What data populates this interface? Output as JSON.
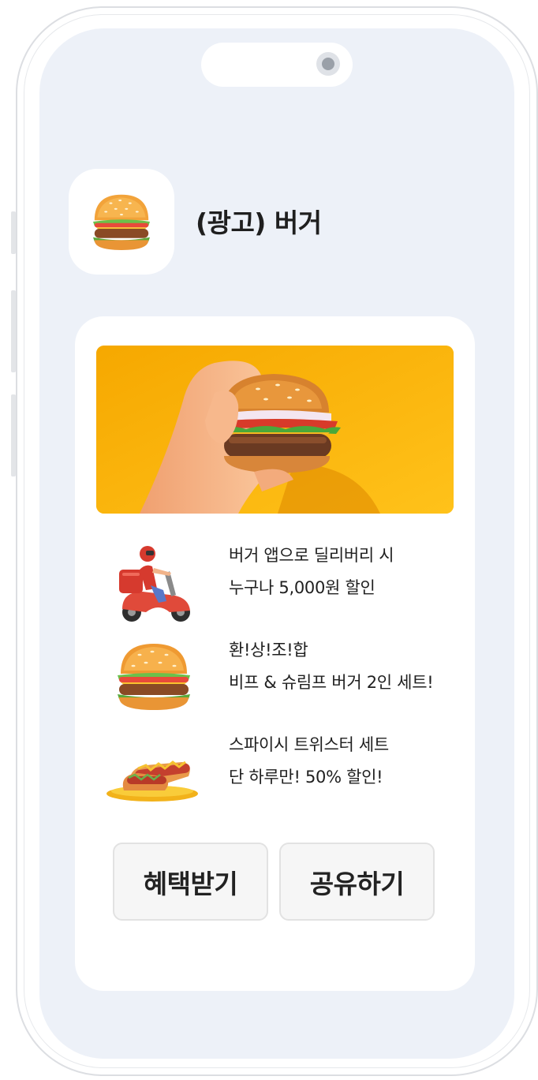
{
  "app": {
    "title": "(광고) 버거",
    "icon": "burger-icon"
  },
  "banner": {
    "image": "hand-holding-burger",
    "background_color": "#fdb50a"
  },
  "features": [
    {
      "icon": "delivery-scooter-icon",
      "line1": "버거 앱으로 딜리버리 시",
      "line2": "누구나 5,000원 할인"
    },
    {
      "icon": "burger-icon",
      "line1": "환!상!조!합",
      "line2": "비프 & 슈림프 버거 2인 세트!"
    },
    {
      "icon": "hotdog-plate-icon",
      "line1": "스파이시 트위스터 세트",
      "line2": "단 하루만! 50% 할인!"
    }
  ],
  "buttons": {
    "benefit": "혜택받기",
    "share": "공유하기"
  },
  "colors": {
    "screen_bg": "#edf1f8",
    "card_bg": "#ffffff",
    "banner_bg": "#fdb50a",
    "button_bg": "#f6f6f6"
  }
}
